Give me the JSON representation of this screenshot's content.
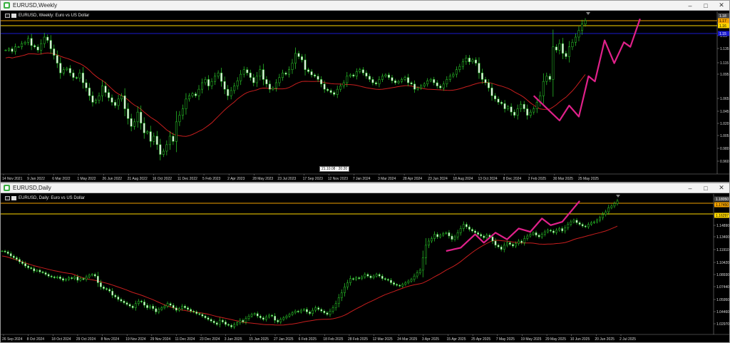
{
  "weekly": {
    "window_title": "EURUSD,Weekly",
    "chart_header": "EURUSD, Weekly: Euro vs US Dollar",
    "crosshair_label": "21.10.08 : 20:20",
    "time_labels": [
      "14 Nov 2021",
      "9 Jan 2022",
      "6 Mar 2022",
      "1 May 2022",
      "26 Jun 2022",
      "21 Aug 2022",
      "16 Oct 2022",
      "11 Dec 2022",
      "5 Feb 2023",
      "2 Apr 2023",
      "28 May 2023",
      "23 Jul 2023",
      "17 Sep 2023",
      "12 Nov 2023",
      "7 Jan 2024",
      "3 Mar 2024",
      "28 Apr 2024",
      "23 Jun 2024",
      "18 Aug 2024",
      "13 Oct 2024",
      "8 Dec 2024",
      "2 Feb 2025",
      "30 Mar 2025",
      "25 May 2025"
    ],
    "price_labels": [
      "1.18",
      "1.15",
      "1.135",
      "1.115",
      "1.095",
      "1.065",
      "1.045",
      "1.020",
      "1.005",
      "0.980",
      "0.960"
    ],
    "price_tags": [
      {
        "text": "1.18",
        "bg": "#444444"
      },
      {
        "text": "1.17",
        "bg": "#f0a000"
      },
      {
        "text": "1.16",
        "bg": "#ffd700"
      },
      {
        "text": "1.15",
        "bg": "#1a1ad0"
      }
    ],
    "price_range": [
      0.94,
      1.185
    ],
    "closes": [
      1.13,
      1.132,
      1.128,
      1.135,
      1.135,
      1.14,
      1.142,
      1.148,
      1.137,
      1.135,
      1.13,
      1.14,
      1.15,
      1.145,
      1.132,
      1.122,
      1.11,
      1.095,
      1.1,
      1.102,
      1.095,
      1.088,
      1.087,
      1.095,
      1.08,
      1.072,
      1.06,
      1.05,
      1.053,
      1.06,
      1.075,
      1.065,
      1.057,
      1.05,
      1.045,
      1.055,
      1.06,
      1.04,
      1.025,
      1.013,
      1.02,
      1.035,
      1.018,
      1.003,
      1.005,
      0.99,
      0.998,
      0.985,
      0.97,
      0.975,
      0.985,
      0.998,
      0.99,
      1.02,
      1.03,
      1.04,
      1.055,
      1.06,
      1.063,
      1.06,
      1.07,
      1.08,
      1.085,
      1.075,
      1.082,
      1.09,
      1.095,
      1.082,
      1.07,
      1.06,
      1.068,
      1.075,
      1.083,
      1.093,
      1.1,
      1.095,
      1.088,
      1.08,
      1.09,
      1.1,
      1.085,
      1.078,
      1.07,
      1.072,
      1.08,
      1.088,
      1.095,
      1.093,
      1.1,
      1.11,
      1.125,
      1.12,
      1.115,
      1.1,
      1.097,
      1.092,
      1.09,
      1.085,
      1.078,
      1.07,
      1.068,
      1.065,
      1.062,
      1.07,
      1.075,
      1.08,
      1.09,
      1.092,
      1.09,
      1.097,
      1.1,
      1.095,
      1.09,
      1.085,
      1.08,
      1.078,
      1.085,
      1.09,
      1.092,
      1.088,
      1.083,
      1.08,
      1.082,
      1.085,
      1.088,
      1.08,
      1.078,
      1.07,
      1.072,
      1.075,
      1.078,
      1.083,
      1.085,
      1.08,
      1.075,
      1.072,
      1.078,
      1.085,
      1.09,
      1.093,
      1.1,
      1.105,
      1.112,
      1.118,
      1.112,
      1.115,
      1.11,
      1.095,
      1.085,
      1.08,
      1.072,
      1.06,
      1.055,
      1.05,
      1.048,
      1.04,
      1.043,
      1.035,
      1.03,
      1.04,
      1.047,
      1.04,
      1.03,
      1.035,
      1.04,
      1.05,
      1.06,
      1.082,
      1.09,
      1.085,
      1.135,
      1.13,
      1.14,
      1.125,
      1.12,
      1.135,
      1.142,
      1.15,
      1.16,
      1.17,
      1.175
    ]
  },
  "daily": {
    "window_title": "EURUSD,Daily",
    "chart_header": "EURUSD, Daily: Euro vs US Dollar",
    "time_labels": [
      "26 Sep 2024",
      "8 Oct 2024",
      "18 Oct 2024",
      "29 Oct 2024",
      "8 Nov 2024",
      "19 Nov 2024",
      "29 Nov 2024",
      "11 Dec 2024",
      "23 Dec 2024",
      "3 Jan 2025",
      "15 Jan 2025",
      "27 Jan 2025",
      "6 Feb 2025",
      "18 Feb 2025",
      "28 Feb 2025",
      "12 Mar 2025",
      "24 Mar 2025",
      "3 Apr 2025",
      "15 Apr 2025",
      "25 Apr 2025",
      "7 May 2025",
      "19 May 2025",
      "29 May 2025",
      "10 Jun 2025",
      "20 Jun 2025",
      "2 Jul 2025"
    ],
    "time_labels_full": [
      "25 Sep 2024",
      "8 Oct 2024",
      "18 Oct 2024",
      "29 Oct 2024",
      "8 Nov 2024",
      "19 Nov 2024",
      "29 Nov 2024",
      "11 Dec 2024",
      "23 Dec 2024",
      "3 Jan 2025",
      "15 Jan 2025",
      "27 Jan 2025",
      "6 Feb 2025",
      "18 Feb 2025",
      "28 Feb 2025",
      "12 Mar 2025",
      "24 Mar 2025",
      "3 Apr 2025",
      "15 Apr 2025",
      "25 Apr 2025",
      "7 May 2025",
      "19 May 2025",
      "29 May 2025",
      "10 Jun 2025",
      "20 Jun 2025",
      "2 Jul 2025"
    ],
    "price_labels": [
      "1.18050",
      "1.17450",
      "1.16297",
      "1.14890",
      "1.13400",
      "1.11910",
      "1.10420",
      "1.08930",
      "1.07440",
      "1.05950",
      "1.04460",
      "1.02970"
    ],
    "price_tags": [
      {
        "text": "1.18050",
        "bg": "#444444"
      },
      {
        "text": "1.17450",
        "bg": "#f0a000"
      },
      {
        "text": "1.16297",
        "bg": "#ffd700"
      }
    ],
    "price_range": [
      1.018,
      1.183
    ],
    "closes": [
      1.118,
      1.117,
      1.115,
      1.112,
      1.11,
      1.108,
      1.105,
      1.103,
      1.1,
      1.098,
      1.097,
      1.094,
      1.095,
      1.093,
      1.092,
      1.09,
      1.088,
      1.087,
      1.086,
      1.087,
      1.085,
      1.083,
      1.084,
      1.086,
      1.085,
      1.087,
      1.083,
      1.085,
      1.084,
      1.087,
      1.089,
      1.09,
      1.088,
      1.08,
      1.075,
      1.073,
      1.072,
      1.07,
      1.065,
      1.063,
      1.06,
      1.058,
      1.056,
      1.054,
      1.052,
      1.05,
      1.055,
      1.058,
      1.057,
      1.053,
      1.05,
      1.052,
      1.049,
      1.045,
      1.048,
      1.05,
      1.052,
      1.055,
      1.053,
      1.05,
      1.047,
      1.049,
      1.052,
      1.05,
      1.048,
      1.046,
      1.045,
      1.043,
      1.042,
      1.04,
      1.038,
      1.036,
      1.034,
      1.032,
      1.03,
      1.035,
      1.033,
      1.03,
      1.029,
      1.027,
      1.03,
      1.032,
      1.035,
      1.033,
      1.037,
      1.04,
      1.042,
      1.043,
      1.04,
      1.038,
      1.036,
      1.039,
      1.041,
      1.04,
      1.035,
      1.033,
      1.036,
      1.038,
      1.04,
      1.042,
      1.044,
      1.046,
      1.045,
      1.047,
      1.048,
      1.045,
      1.043,
      1.047,
      1.05,
      1.048,
      1.046,
      1.044,
      1.042,
      1.046,
      1.05,
      1.055,
      1.062,
      1.068,
      1.075,
      1.08,
      1.085,
      1.084,
      1.086,
      1.085,
      1.087,
      1.09,
      1.088,
      1.086,
      1.088,
      1.09,
      1.088,
      1.085,
      1.084,
      1.083,
      1.08,
      1.078,
      1.077,
      1.076,
      1.078,
      1.08,
      1.082,
      1.084,
      1.088,
      1.092,
      1.095,
      1.11,
      1.125,
      1.13,
      1.133,
      1.138,
      1.135,
      1.137,
      1.139,
      1.14,
      1.136,
      1.132,
      1.135,
      1.14,
      1.145,
      1.15,
      1.147,
      1.144,
      1.142,
      1.14,
      1.138,
      1.136,
      1.134,
      1.137,
      1.135,
      1.13,
      1.125,
      1.123,
      1.12,
      1.125,
      1.128,
      1.126,
      1.124,
      1.127,
      1.13,
      1.128,
      1.133,
      1.136,
      1.138,
      1.14,
      1.137,
      1.135,
      1.138,
      1.141,
      1.143,
      1.142,
      1.14,
      1.143,
      1.145,
      1.142,
      1.146,
      1.15,
      1.153,
      1.155,
      1.152,
      1.15,
      1.148,
      1.147,
      1.15,
      1.152,
      1.153,
      1.155,
      1.158,
      1.162,
      1.165,
      1.17,
      1.172,
      1.175,
      1.178
    ]
  }
}
